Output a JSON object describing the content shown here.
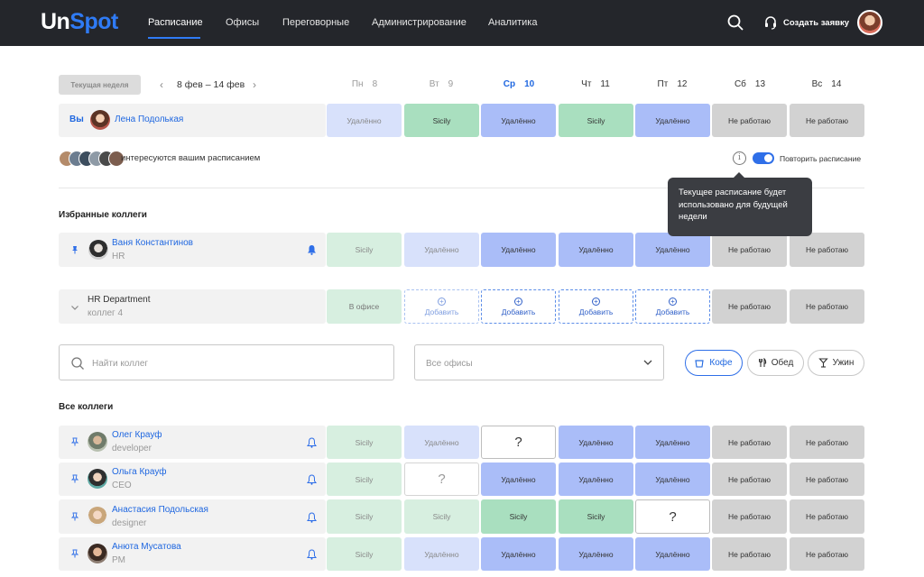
{
  "nav": {
    "logo_a": "Un",
    "logo_b": "Spot",
    "items": [
      "Расписание",
      "Офисы",
      "Переговорные",
      "Администрирование",
      "Аналитика"
    ],
    "create_request": "Создать заявку"
  },
  "week": {
    "current_label": "Текущая неделя",
    "range": "8 фев – 14 фев",
    "days": [
      {
        "name": "Пн",
        "num": "8"
      },
      {
        "name": "Вт",
        "num": "9"
      },
      {
        "name": "Ср",
        "num": "10"
      },
      {
        "name": "Чт",
        "num": "11"
      },
      {
        "name": "Пт",
        "num": "12"
      },
      {
        "name": "Сб",
        "num": "13"
      },
      {
        "name": "Вс",
        "num": "14"
      }
    ]
  },
  "you": {
    "label": "Вы",
    "name": "Лена Подолькая",
    "cells": [
      "Удалённо",
      "Sicily",
      "Удалённо",
      "Sicily",
      "Удалённо",
      "Не работаю",
      "Не работаю"
    ]
  },
  "watchers_text": "интересуются вашим расписанием",
  "repeat_label": "Повторить расписание",
  "tooltip": "Текущее расписание будет использовано для будущей недели",
  "favorites": {
    "title": "Избранные коллеги",
    "person": {
      "name": "Ваня Константинов",
      "role": "HR",
      "cells": [
        "Sicily",
        "Удалённо",
        "Удалённо",
        "Удалённо",
        "Удалённо",
        "Не работаю",
        "Не работаю"
      ]
    },
    "department": {
      "name": "HR Department",
      "count": "коллег 4",
      "cells": [
        "В офисе",
        "Добавить",
        "Добавить",
        "Добавить",
        "Добавить",
        "Не работаю",
        "Не работаю"
      ]
    }
  },
  "filters": {
    "search_placeholder": "Найти коллег",
    "office_value": "Все офисы",
    "pills": [
      "Кофе",
      "Обед",
      "Ужин"
    ]
  },
  "all": {
    "title": "Все коллеги",
    "rows": [
      {
        "name": "Олег Крауф",
        "role": "developer",
        "cells": [
          "Sicily",
          "Удалённо",
          "?",
          "Удалённо",
          "Удалённо",
          "Не работаю",
          "Не работаю"
        ]
      },
      {
        "name": "Ольга Крауф",
        "role": "CEO",
        "cells": [
          "Sicily",
          "?",
          "Удалённо",
          "Удалённо",
          "Удалённо",
          "Не работаю",
          "Не работаю"
        ]
      },
      {
        "name": "Анастасия Подольская",
        "role": "designer",
        "cells": [
          "Sicily",
          "Sicily",
          "Sicily",
          "Sicily",
          "?",
          "Не работаю",
          "Не работаю"
        ]
      },
      {
        "name": "Анюта Мусатова",
        "role": "PM",
        "cells": [
          "Sicily",
          "Удалённо",
          "Удалённо",
          "Удалённо",
          "Удалённо",
          "Не работаю",
          "Не работаю"
        ]
      }
    ]
  },
  "colors": {
    "accent": "#2f6fe8",
    "remote": "#aabdf8",
    "sicily": "#a9dfbf",
    "off": "#d2d2d2",
    "topbar": "#24262b"
  }
}
